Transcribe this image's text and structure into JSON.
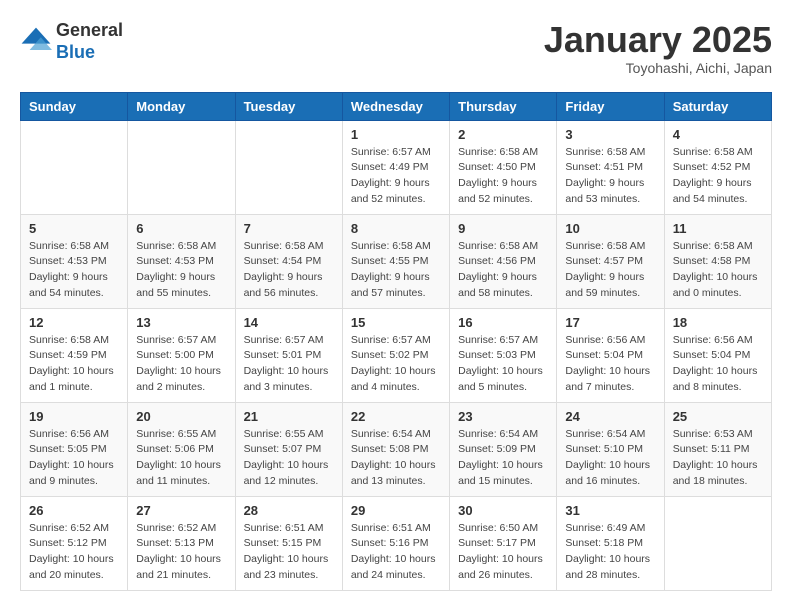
{
  "logo": {
    "general": "General",
    "blue": "Blue"
  },
  "title": "January 2025",
  "subtitle": "Toyohashi, Aichi, Japan",
  "headers": [
    "Sunday",
    "Monday",
    "Tuesday",
    "Wednesday",
    "Thursday",
    "Friday",
    "Saturday"
  ],
  "weeks": [
    [
      {
        "day": "",
        "info": ""
      },
      {
        "day": "",
        "info": ""
      },
      {
        "day": "",
        "info": ""
      },
      {
        "day": "1",
        "info": "Sunrise: 6:57 AM\nSunset: 4:49 PM\nDaylight: 9 hours\nand 52 minutes."
      },
      {
        "day": "2",
        "info": "Sunrise: 6:58 AM\nSunset: 4:50 PM\nDaylight: 9 hours\nand 52 minutes."
      },
      {
        "day": "3",
        "info": "Sunrise: 6:58 AM\nSunset: 4:51 PM\nDaylight: 9 hours\nand 53 minutes."
      },
      {
        "day": "4",
        "info": "Sunrise: 6:58 AM\nSunset: 4:52 PM\nDaylight: 9 hours\nand 54 minutes."
      }
    ],
    [
      {
        "day": "5",
        "info": "Sunrise: 6:58 AM\nSunset: 4:53 PM\nDaylight: 9 hours\nand 54 minutes."
      },
      {
        "day": "6",
        "info": "Sunrise: 6:58 AM\nSunset: 4:53 PM\nDaylight: 9 hours\nand 55 minutes."
      },
      {
        "day": "7",
        "info": "Sunrise: 6:58 AM\nSunset: 4:54 PM\nDaylight: 9 hours\nand 56 minutes."
      },
      {
        "day": "8",
        "info": "Sunrise: 6:58 AM\nSunset: 4:55 PM\nDaylight: 9 hours\nand 57 minutes."
      },
      {
        "day": "9",
        "info": "Sunrise: 6:58 AM\nSunset: 4:56 PM\nDaylight: 9 hours\nand 58 minutes."
      },
      {
        "day": "10",
        "info": "Sunrise: 6:58 AM\nSunset: 4:57 PM\nDaylight: 9 hours\nand 59 minutes."
      },
      {
        "day": "11",
        "info": "Sunrise: 6:58 AM\nSunset: 4:58 PM\nDaylight: 10 hours\nand 0 minutes."
      }
    ],
    [
      {
        "day": "12",
        "info": "Sunrise: 6:58 AM\nSunset: 4:59 PM\nDaylight: 10 hours\nand 1 minute."
      },
      {
        "day": "13",
        "info": "Sunrise: 6:57 AM\nSunset: 5:00 PM\nDaylight: 10 hours\nand 2 minutes."
      },
      {
        "day": "14",
        "info": "Sunrise: 6:57 AM\nSunset: 5:01 PM\nDaylight: 10 hours\nand 3 minutes."
      },
      {
        "day": "15",
        "info": "Sunrise: 6:57 AM\nSunset: 5:02 PM\nDaylight: 10 hours\nand 4 minutes."
      },
      {
        "day": "16",
        "info": "Sunrise: 6:57 AM\nSunset: 5:03 PM\nDaylight: 10 hours\nand 5 minutes."
      },
      {
        "day": "17",
        "info": "Sunrise: 6:56 AM\nSunset: 5:04 PM\nDaylight: 10 hours\nand 7 minutes."
      },
      {
        "day": "18",
        "info": "Sunrise: 6:56 AM\nSunset: 5:04 PM\nDaylight: 10 hours\nand 8 minutes."
      }
    ],
    [
      {
        "day": "19",
        "info": "Sunrise: 6:56 AM\nSunset: 5:05 PM\nDaylight: 10 hours\nand 9 minutes."
      },
      {
        "day": "20",
        "info": "Sunrise: 6:55 AM\nSunset: 5:06 PM\nDaylight: 10 hours\nand 11 minutes."
      },
      {
        "day": "21",
        "info": "Sunrise: 6:55 AM\nSunset: 5:07 PM\nDaylight: 10 hours\nand 12 minutes."
      },
      {
        "day": "22",
        "info": "Sunrise: 6:54 AM\nSunset: 5:08 PM\nDaylight: 10 hours\nand 13 minutes."
      },
      {
        "day": "23",
        "info": "Sunrise: 6:54 AM\nSunset: 5:09 PM\nDaylight: 10 hours\nand 15 minutes."
      },
      {
        "day": "24",
        "info": "Sunrise: 6:54 AM\nSunset: 5:10 PM\nDaylight: 10 hours\nand 16 minutes."
      },
      {
        "day": "25",
        "info": "Sunrise: 6:53 AM\nSunset: 5:11 PM\nDaylight: 10 hours\nand 18 minutes."
      }
    ],
    [
      {
        "day": "26",
        "info": "Sunrise: 6:52 AM\nSunset: 5:12 PM\nDaylight: 10 hours\nand 20 minutes."
      },
      {
        "day": "27",
        "info": "Sunrise: 6:52 AM\nSunset: 5:13 PM\nDaylight: 10 hours\nand 21 minutes."
      },
      {
        "day": "28",
        "info": "Sunrise: 6:51 AM\nSunset: 5:15 PM\nDaylight: 10 hours\nand 23 minutes."
      },
      {
        "day": "29",
        "info": "Sunrise: 6:51 AM\nSunset: 5:16 PM\nDaylight: 10 hours\nand 24 minutes."
      },
      {
        "day": "30",
        "info": "Sunrise: 6:50 AM\nSunset: 5:17 PM\nDaylight: 10 hours\nand 26 minutes."
      },
      {
        "day": "31",
        "info": "Sunrise: 6:49 AM\nSunset: 5:18 PM\nDaylight: 10 hours\nand 28 minutes."
      },
      {
        "day": "",
        "info": ""
      }
    ]
  ]
}
